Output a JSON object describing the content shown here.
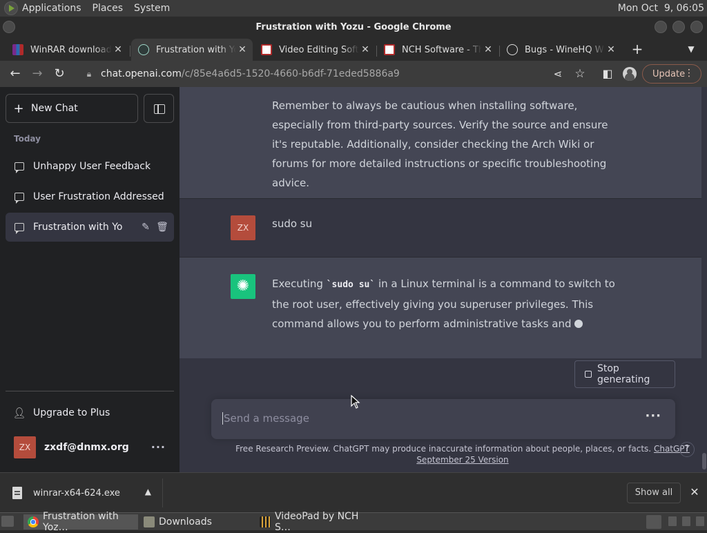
{
  "desktop": {
    "menus": [
      "Applications",
      "Places",
      "System"
    ],
    "clock": "Mon Oct  9, 06:05"
  },
  "window": {
    "title": "Frustration with Yozu - Google Chrome"
  },
  "tabs": [
    {
      "label": "WinRAR download f",
      "favicon": "winrar-icon",
      "active": false
    },
    {
      "label": "Frustration with Yozu",
      "favicon": "chatgpt-icon",
      "active": true
    },
    {
      "label": "Video Editing Softw",
      "favicon": "nch-icon",
      "active": false
    },
    {
      "label": "NCH Software - Tha",
      "favicon": "nch-icon",
      "active": false
    },
    {
      "label": "Bugs - WineHQ Wiki",
      "favicon": "globe-icon",
      "active": false
    }
  ],
  "toolbar": {
    "url_host": "chat.openai.com",
    "url_path": "/c/85e4a6d5-1520-4660-b6df-71eded5886a9",
    "update_label": "Update"
  },
  "sidebar": {
    "new_chat_label": "New Chat",
    "section_label": "Today",
    "items": [
      {
        "label": "Unhappy User Feedback",
        "active": false
      },
      {
        "label": "User Frustration Addressed",
        "active": false
      },
      {
        "label": "Frustration with Yozu",
        "active": true
      }
    ],
    "upgrade_label": "Upgrade to Plus",
    "account_email": "zxdf@dnmx.org",
    "avatar_initials": "ZX"
  },
  "conversation": {
    "assistant_prev": "Remember to always be cautious when installing software, especially from third-party sources. Verify the source and ensure it's reputable. Additionally, consider checking the Arch Wiki or forums for more detailed instructions or specific troubleshooting advice.",
    "user_message": "sudo su",
    "assistant_current": {
      "prefix": "Executing ",
      "code": "`sudo su`",
      "suffix": " in a Linux terminal is a command to switch to the root user, effectively giving you superuser privileges. This command allows you to perform administrative tasks and"
    }
  },
  "composer": {
    "stop_label": "Stop generating",
    "placeholder": "Send a message",
    "disclaimer": "Free Research Preview. ChatGPT may produce inaccurate information about people, places, or facts.",
    "version_link": "ChatGPT September 25 Version",
    "help": "?"
  },
  "downloads": {
    "file_name": "winrar-x64-624.exe",
    "show_all_label": "Show all"
  },
  "taskbar": {
    "items": [
      {
        "label": "Frustration with Yoz…",
        "icon": "chrome-icon",
        "active": true
      },
      {
        "label": "Downloads",
        "icon": "folder-icon",
        "active": false
      },
      {
        "label": "VideoPad by NCH S…",
        "icon": "videopad-icon",
        "active": false
      }
    ]
  },
  "colors": {
    "sidebar_bg": "#202123",
    "chat_bg": "#343541",
    "assistant_bg": "#444654",
    "gpt_green": "#19c37d",
    "user_avatar": "#b44c3c"
  }
}
